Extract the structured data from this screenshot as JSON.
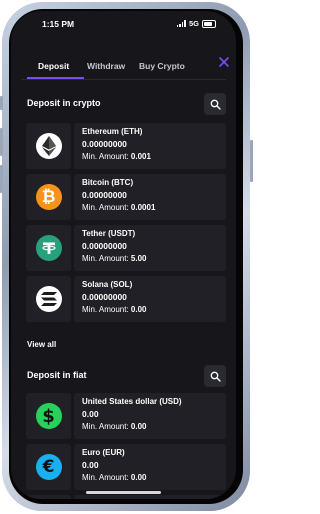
{
  "status": {
    "time": "1:15 PM",
    "network": "5G"
  },
  "tabs": [
    {
      "label": "Deposit",
      "active": true
    },
    {
      "label": "Withdraw",
      "active": false
    },
    {
      "label": "Buy Crypto",
      "active": false
    }
  ],
  "crypto_section": {
    "title": "Deposit in crypto",
    "items": [
      {
        "name": "Ethereum (ETH)",
        "amount": "0.00000000",
        "min_label": "Min. Amount:",
        "min_value": "0.001",
        "icon": "ethereum-icon",
        "color": "#ffffff"
      },
      {
        "name": "Bitcoin (BTC)",
        "amount": "0.00000000",
        "min_label": "Min. Amount:",
        "min_value": "0.0001",
        "icon": "bitcoin-icon",
        "color": "#f7931a"
      },
      {
        "name": "Tether (USDT)",
        "amount": "0.00000000",
        "min_label": "Min. Amount:",
        "min_value": "5.00",
        "icon": "tether-icon",
        "color": "#26a17b"
      },
      {
        "name": "Solana (SOL)",
        "amount": "0.00000000",
        "min_label": "Min. Amount:",
        "min_value": "0.00",
        "icon": "solana-icon",
        "color": "#ffffff"
      }
    ],
    "view_all": "View all"
  },
  "fiat_section": {
    "title": "Deposit in fiat",
    "items": [
      {
        "name": "United States dollar (USD)",
        "amount": "0.00",
        "min_label": "Min. Amount:",
        "min_value": "0.00",
        "icon": "dollar-icon",
        "color": "#27d15b"
      },
      {
        "name": "Euro (EUR)",
        "amount": "0.00",
        "min_label": "Min. Amount:",
        "min_value": "0.00",
        "icon": "euro-icon",
        "color": "#1ab0ef"
      }
    ]
  },
  "colors": {
    "accent": "#7b4cf0",
    "background": "#16161b",
    "card": "#202026"
  }
}
